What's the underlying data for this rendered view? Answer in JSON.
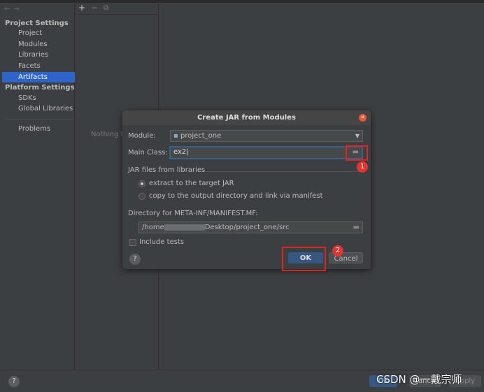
{
  "sidebar": {
    "back": "←",
    "forward": "→",
    "project_settings": "Project Settings",
    "items": [
      "Project",
      "Modules",
      "Libraries",
      "Facets",
      "Artifacts"
    ],
    "platform_settings": "Platform Settings",
    "platform_items": [
      "SDKs",
      "Global Libraries"
    ],
    "problems": "Problems"
  },
  "toolbar": {
    "add": "+",
    "remove": "−",
    "copy": "⧉"
  },
  "main": {
    "empty_text": "Nothing to"
  },
  "dialog": {
    "title": "Create JAR from Modules",
    "module_label": "Module:",
    "module_value": "project_one",
    "main_class_label": "Main Class:",
    "main_class_value": "ex2",
    "jar_group": "JAR files from libraries",
    "option_extract": "extract to the target JAR",
    "option_copy": "copy to the output directory and link via manifest",
    "selected_option": "extract",
    "dir_label": "Directory for META-INF/MANIFEST.MF:",
    "dir_prefix": "/home",
    "dir_suffix": "Desktop/project_one/src",
    "include_tests": "Include tests",
    "include_tests_checked": false,
    "ok": "OK",
    "cancel": "Cancel",
    "help": "?"
  },
  "annotations": [
    "1",
    "2"
  ],
  "footer": {
    "help": "?",
    "ok": "OK",
    "cancel": "Cancel",
    "apply": "Apply"
  },
  "watermark": "CSDN @一戴宗师",
  "colors": {
    "accent": "#2f65ca",
    "annotation": "#e02424"
  }
}
